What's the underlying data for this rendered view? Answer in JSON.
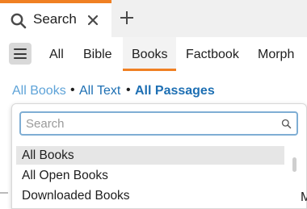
{
  "tab": {
    "label": "Search",
    "close_icon": "close-icon",
    "search_icon": "search-icon",
    "accent": "#f08023"
  },
  "new_tab_icon": "plus-icon",
  "nav": {
    "menu_icon": "hamburger-menu-icon",
    "tabs": [
      "All",
      "Bible",
      "Books",
      "Factbook",
      "Morph"
    ],
    "active": "Books"
  },
  "filters": {
    "items": [
      "All Books",
      "All Text",
      "All Passages"
    ],
    "colors": {
      "light": "#5ea3d8",
      "dark": "#1d6fb3"
    }
  },
  "dropdown": {
    "search_placeholder": "Search",
    "items": [
      "All Books",
      "All Open Books",
      "Downloaded Books"
    ],
    "selected": "All Books"
  },
  "partial_text": "M"
}
